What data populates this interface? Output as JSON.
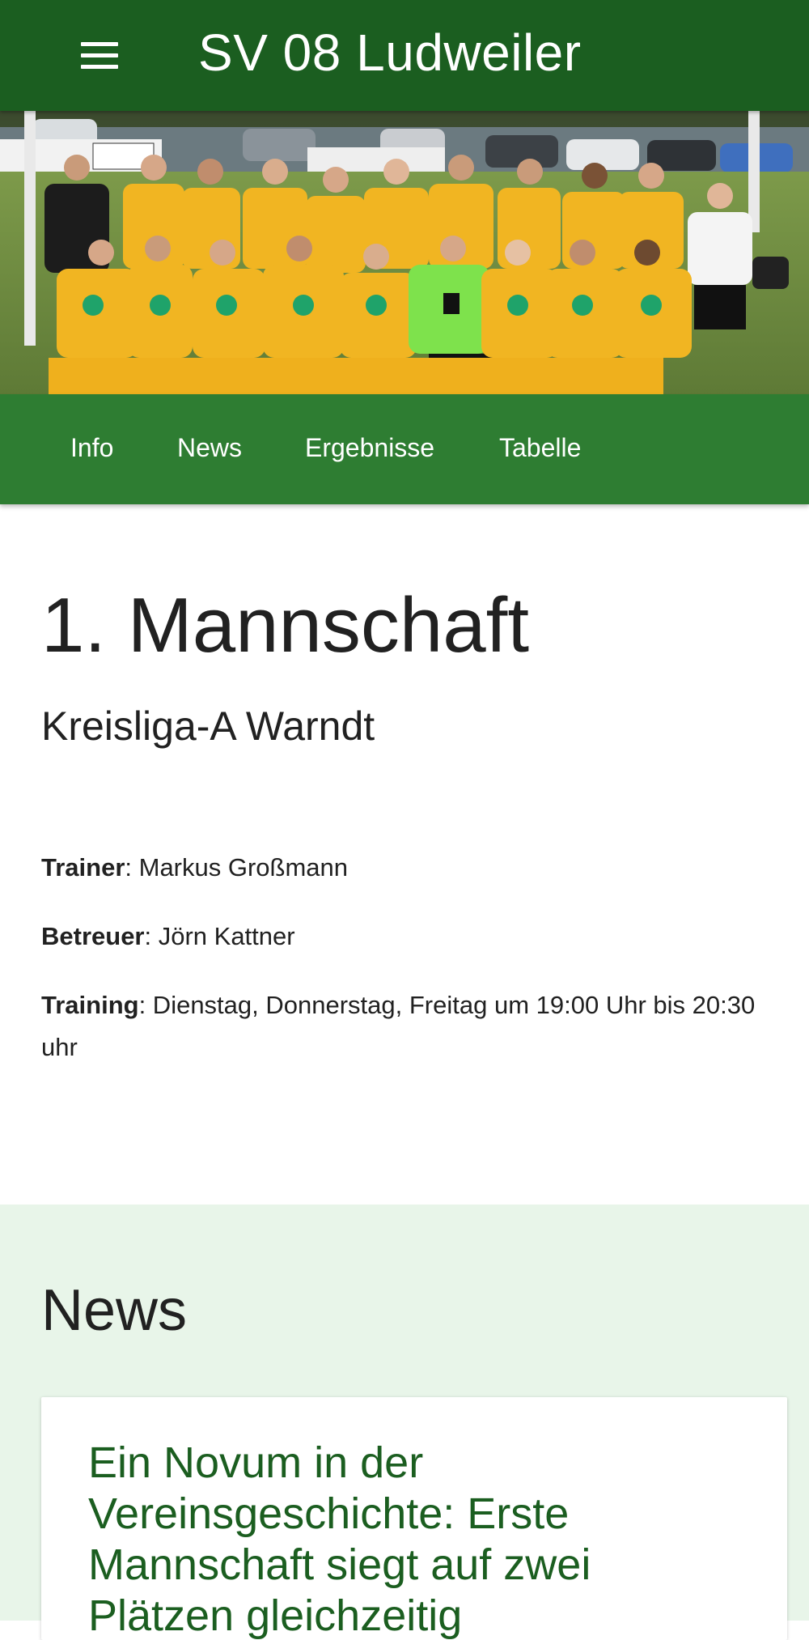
{
  "header": {
    "title": "SV 08 Ludweiler",
    "menu_icon": "hamburger-menu-icon"
  },
  "hero": {
    "image": "team-photo"
  },
  "tabs": [
    {
      "label": "Info"
    },
    {
      "label": "News"
    },
    {
      "label": "Ergebnisse"
    },
    {
      "label": "Tabelle"
    }
  ],
  "team": {
    "title": "1. Mannschaft",
    "league": "Kreisliga-A Warndt",
    "trainer_label": "Trainer",
    "trainer_value": ": Markus Großmann",
    "betreuer_label": "Betreuer",
    "betreuer_value": ": Jörn Kattner",
    "training_label": "Training",
    "training_value": ": Dienstag, Donnerstag, Freitag um 19:00 Uhr bis 20:30 uhr"
  },
  "news": {
    "heading": "News",
    "items": [
      {
        "title": "Ein Novum in der Vereinsgeschichte: Erste Mannschaft siegt auf zwei Plätzen gleichzeitig"
      }
    ]
  },
  "colors": {
    "appbar": "#1b5e20",
    "tabbar": "#2e7d32",
    "news_bg": "#e8f5e9",
    "link": "#1b5e20"
  }
}
